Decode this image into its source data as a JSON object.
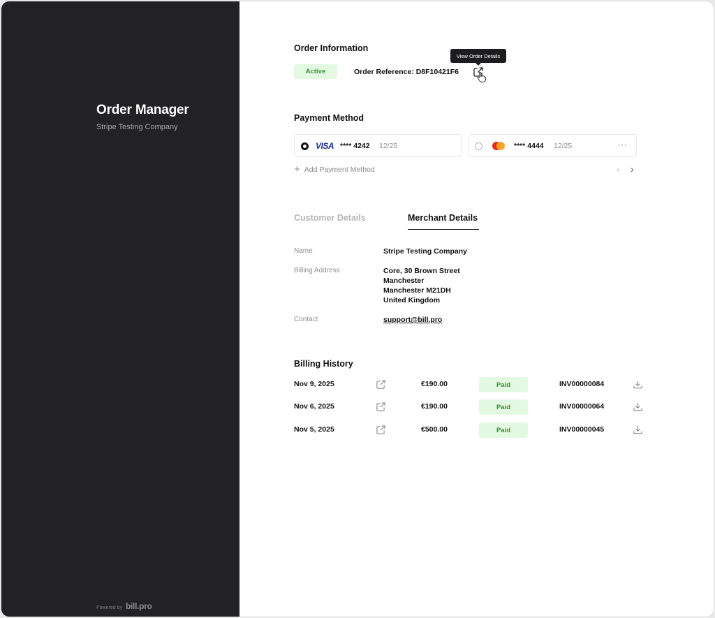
{
  "sidebar": {
    "title": "Order Manager",
    "subtitle": "Stripe Testing Company",
    "powered_by": "Powered by",
    "brand": "bill.pro"
  },
  "order_info": {
    "heading": "Order Information",
    "status": "Active",
    "reference": "Order Reference: D8F10421F6",
    "tooltip": "View Order Details"
  },
  "payment": {
    "heading": "Payment Method",
    "cards": [
      {
        "brand": "VISA",
        "number": "**** 4242",
        "expiry": "12/25",
        "selected": true
      },
      {
        "brand": "mastercard",
        "number": "**** 4444",
        "expiry": "12/25",
        "selected": false
      }
    ],
    "more": "···",
    "add_label": "Add Payment Method",
    "prev": "‹",
    "next": "›"
  },
  "tabs": [
    {
      "label": "Customer Details",
      "active": false
    },
    {
      "label": "Merchant Details",
      "active": true
    }
  ],
  "merchant": {
    "name_label": "Name",
    "name": "Stripe Testing Company",
    "address_label": "Billing Address",
    "address": [
      "Core, 30 Brown Street",
      "Manchester",
      "Manchester M21DH",
      "United Kingdom"
    ],
    "contact_label": "Contact",
    "contact": "support@bill.pro"
  },
  "billing_history": {
    "heading": "Billing History",
    "rows": [
      {
        "date": "Nov 9, 2025",
        "amount": "€190.00",
        "status": "Paid",
        "invoice": "INV00000084"
      },
      {
        "date": "Nov 6, 2025",
        "amount": "€190.00",
        "status": "Paid",
        "invoice": "INV00000064"
      },
      {
        "date": "Nov 5, 2025",
        "amount": "€500.00",
        "status": "Paid",
        "invoice": "INV00000045"
      }
    ]
  },
  "colors": {
    "sidebar_bg": "#222224",
    "badge_bg": "#e4f9e2",
    "badge_text": "#3b8c3a"
  }
}
